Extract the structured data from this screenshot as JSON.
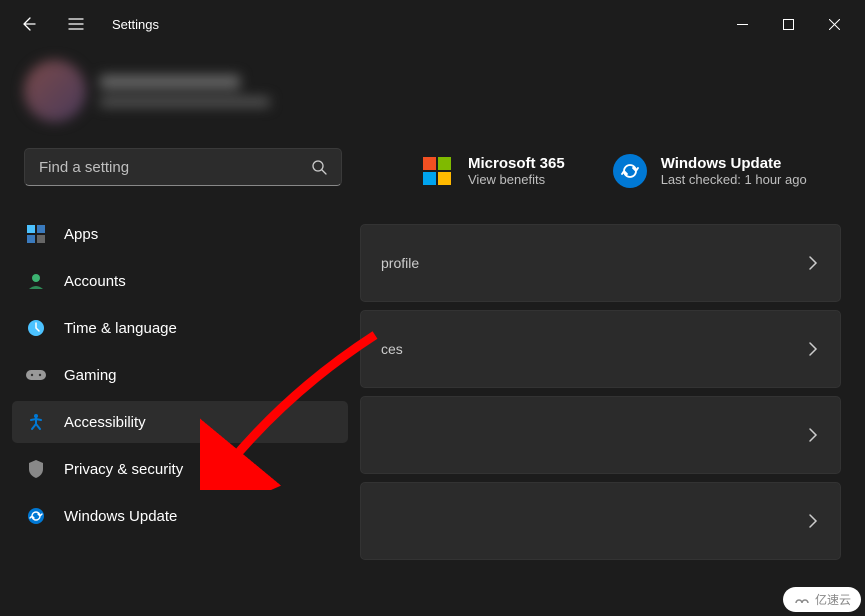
{
  "titlebar": {
    "title": "Settings"
  },
  "search": {
    "placeholder": "Find a setting"
  },
  "sidebar": {
    "items": [
      {
        "label": "Apps"
      },
      {
        "label": "Accounts"
      },
      {
        "label": "Time & language"
      },
      {
        "label": "Gaming"
      },
      {
        "label": "Accessibility"
      },
      {
        "label": "Privacy & security"
      },
      {
        "label": "Windows Update"
      }
    ]
  },
  "promos": {
    "m365": {
      "title": "Microsoft 365",
      "subtitle": "View benefits"
    },
    "wu": {
      "title": "Windows Update",
      "subtitle": "Last checked: 1 hour ago"
    }
  },
  "cards": {
    "c1": "profile",
    "c2": "ces"
  },
  "watermark": "亿速云"
}
